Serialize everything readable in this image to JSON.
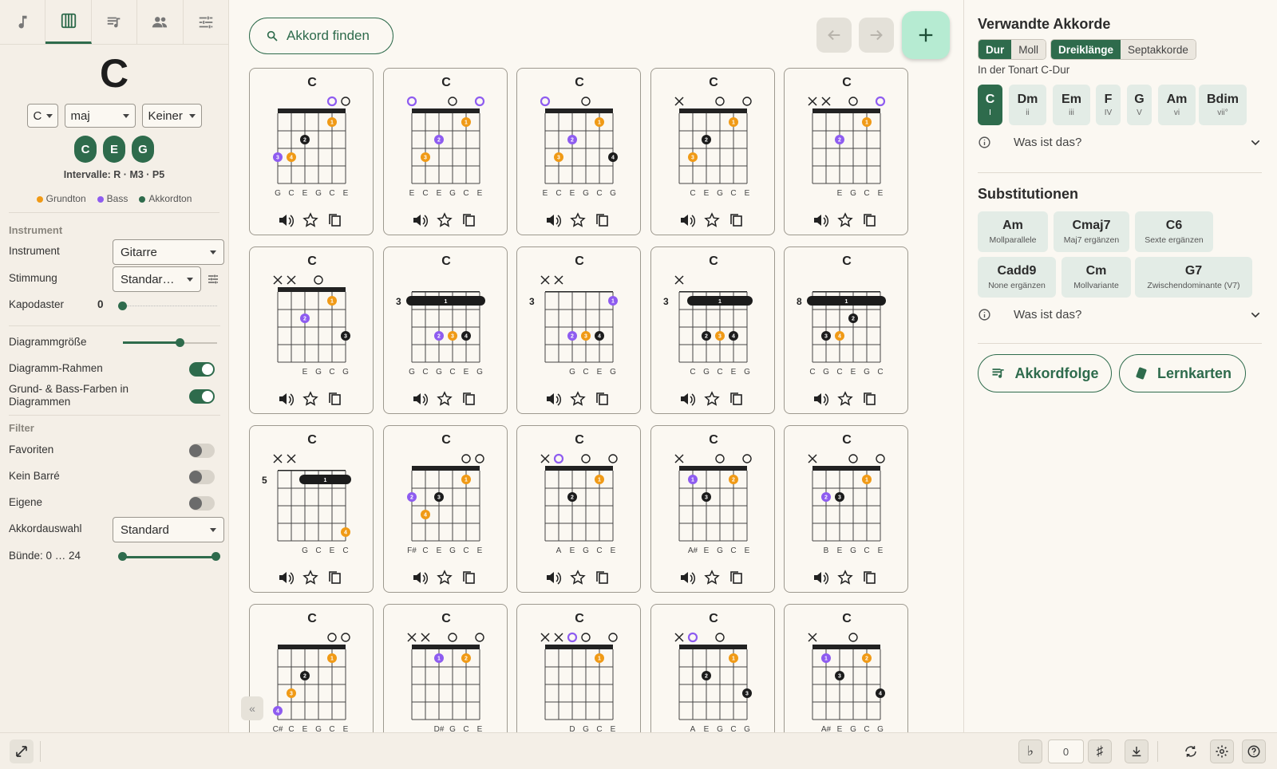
{
  "left": {
    "tabs": [
      "music-note-icon",
      "piano-icon",
      "playlist-icon",
      "people-icon",
      "tune-icon"
    ],
    "chord_name": "C",
    "root_select": "C",
    "quality_select": "maj",
    "bass_select": "Keiner",
    "notes": [
      "C",
      "E",
      "G"
    ],
    "intervals": "Intervalle: R · M3 · P5",
    "legend": {
      "root": "Grundton",
      "bass": "Bass",
      "chord_tone": "Akkordton"
    },
    "instrument_section": "Instrument",
    "instrument_label": "Instrument",
    "instrument_value": "Gitarre",
    "tuning_label": "Stimmung",
    "tuning_value": "Standar…",
    "capo_label": "Kapodaster",
    "capo_value": "0",
    "diagram_size_label": "Diagrammgröße",
    "diagram_size_level": 0.6,
    "frame_label": "Diagramm-Rahmen",
    "colors_label": "Grund- & Bass-Farben in Diagrammen",
    "filter_section": "Filter",
    "favorites_label": "Favoriten",
    "no_barre_label": "Kein Barré",
    "own_label": "Eigene",
    "selection_label": "Akkordauswahl",
    "selection_value": "Standard",
    "frets_label": "Bünde: 0 … 24"
  },
  "main": {
    "search_label": "Akkord finden",
    "cards": [
      {
        "title": "C",
        "fret": "",
        "markers": [
          "",
          "",
          "",
          "",
          "o",
          "o"
        ],
        "labels": [
          "G",
          "C",
          "E",
          "G",
          "C",
          "E"
        ]
      },
      {
        "title": "C",
        "fret": "",
        "markers": [
          "o",
          "",
          "",
          "o",
          "",
          "o"
        ],
        "labels": [
          "E",
          "C",
          "E",
          "G",
          "C",
          "E"
        ]
      },
      {
        "title": "C",
        "fret": "",
        "markers": [
          "o",
          "",
          "",
          "o",
          "",
          ""
        ],
        "labels": [
          "E",
          "C",
          "E",
          "G",
          "C",
          "G"
        ]
      },
      {
        "title": "C",
        "fret": "",
        "markers": [
          "x",
          "",
          "",
          "o",
          "",
          "o"
        ],
        "labels": [
          "",
          "C",
          "E",
          "G",
          "C",
          "E"
        ]
      },
      {
        "title": "C",
        "fret": "",
        "markers": [
          "x",
          "x",
          "",
          "o",
          "",
          "o"
        ],
        "labels": [
          "",
          "",
          "E",
          "G",
          "C",
          "E"
        ]
      },
      {
        "title": "C",
        "fret": "",
        "markers": [
          "x",
          "x",
          "",
          "o",
          "",
          ""
        ],
        "labels": [
          "",
          "",
          "E",
          "G",
          "C",
          "G"
        ]
      },
      {
        "title": "C",
        "fret": "3",
        "markers": [
          "",
          "",
          "",
          "",
          "",
          ""
        ],
        "labels": [
          "G",
          "C",
          "G",
          "C",
          "E",
          "G"
        ]
      },
      {
        "title": "C",
        "fret": "3",
        "markers": [
          "x",
          "x",
          "",
          "",
          "",
          ""
        ],
        "labels": [
          "",
          "",
          "G",
          "C",
          "E",
          "G"
        ]
      },
      {
        "title": "C",
        "fret": "3",
        "markers": [
          "x",
          "",
          "",
          "",
          "",
          ""
        ],
        "labels": [
          "",
          "C",
          "G",
          "C",
          "E",
          "G"
        ]
      },
      {
        "title": "C",
        "fret": "8",
        "markers": [
          "",
          "",
          "",
          "",
          "",
          ""
        ],
        "labels": [
          "C",
          "G",
          "C",
          "E",
          "G",
          "C"
        ]
      },
      {
        "title": "C",
        "fret": "5",
        "markers": [
          "x",
          "x",
          "",
          "",
          "",
          ""
        ],
        "labels": [
          "",
          "",
          "G",
          "C",
          "E",
          "C"
        ]
      },
      {
        "title": "C",
        "fret": "",
        "markers": [
          "",
          "",
          "",
          "",
          "o",
          "o"
        ],
        "labels": [
          "F#",
          "C",
          "E",
          "G",
          "C",
          "E"
        ]
      },
      {
        "title": "C",
        "fret": "",
        "markers": [
          "x",
          "o",
          "",
          "o",
          "",
          "o"
        ],
        "labels": [
          "",
          "A",
          "E",
          "G",
          "C",
          "E"
        ]
      },
      {
        "title": "C",
        "fret": "",
        "markers": [
          "x",
          "",
          "",
          "o",
          "",
          "o"
        ],
        "labels": [
          "",
          "A#",
          "E",
          "G",
          "C",
          "E"
        ]
      },
      {
        "title": "C",
        "fret": "",
        "markers": [
          "x",
          "",
          "",
          "o",
          "",
          "o"
        ],
        "labels": [
          "",
          "B",
          "E",
          "G",
          "C",
          "E"
        ]
      },
      {
        "title": "C",
        "fret": "",
        "markers": [
          "",
          "",
          "",
          "",
          "o",
          "o"
        ],
        "labels": [
          "C#",
          "C",
          "E",
          "G",
          "C",
          "E"
        ]
      },
      {
        "title": "C",
        "fret": "",
        "markers": [
          "x",
          "x",
          "",
          "o",
          "",
          "o"
        ],
        "labels": [
          "",
          "",
          "D#",
          "G",
          "C",
          "E"
        ]
      },
      {
        "title": "C",
        "fret": "",
        "markers": [
          "x",
          "x",
          "o",
          "o",
          "",
          "o"
        ],
        "labels": [
          "",
          "",
          "D",
          "G",
          "C",
          "E"
        ]
      },
      {
        "title": "C",
        "fret": "",
        "markers": [
          "x",
          "o",
          "",
          "o",
          "",
          ""
        ],
        "labels": [
          "",
          "A",
          "E",
          "G",
          "C",
          "G"
        ]
      },
      {
        "title": "C",
        "fret": "",
        "markers": [
          "x",
          "",
          "",
          "o",
          "",
          ""
        ],
        "labels": [
          "",
          "A#",
          "E",
          "G",
          "C",
          "G"
        ]
      }
    ]
  },
  "right": {
    "related_title": "Verwandte Akkorde",
    "seg1": [
      "Dur",
      "Moll"
    ],
    "seg2": [
      "Dreiklänge",
      "Septakkorde"
    ],
    "key_text": "In der Tonart C-Dur",
    "keys": [
      {
        "n": "C",
        "d": "I"
      },
      {
        "n": "Dm",
        "d": "ii"
      },
      {
        "n": "Em",
        "d": "iii"
      },
      {
        "n": "F",
        "d": "IV"
      },
      {
        "n": "G",
        "d": "V"
      },
      {
        "n": "Am",
        "d": "vi"
      },
      {
        "n": "Bdim",
        "d": "vii°"
      }
    ],
    "what_is": "Was ist das?",
    "subs_title": "Substitutionen",
    "subs": [
      {
        "n": "Am",
        "d": "Mollparallele"
      },
      {
        "n": "Cmaj7",
        "d": "Maj7 ergänzen"
      },
      {
        "n": "C6",
        "d": "Sexte ergänzen"
      },
      {
        "n": "Cadd9",
        "d": "None ergänzen"
      },
      {
        "n": "Cm",
        "d": "Mollvariante"
      },
      {
        "n": "G7",
        "d": "Zwischendominante (V7)"
      }
    ],
    "what_is2": "Was ist das?",
    "progression_label": "Akkordfolge",
    "flashcards_label": "Lernkarten"
  },
  "bottom": {
    "transpose_value": "0"
  },
  "colors": {
    "accent": "#2e6b4c",
    "root": "#f09a16",
    "bass": "#8e5cf0",
    "tone": "#1c1c1c"
  }
}
